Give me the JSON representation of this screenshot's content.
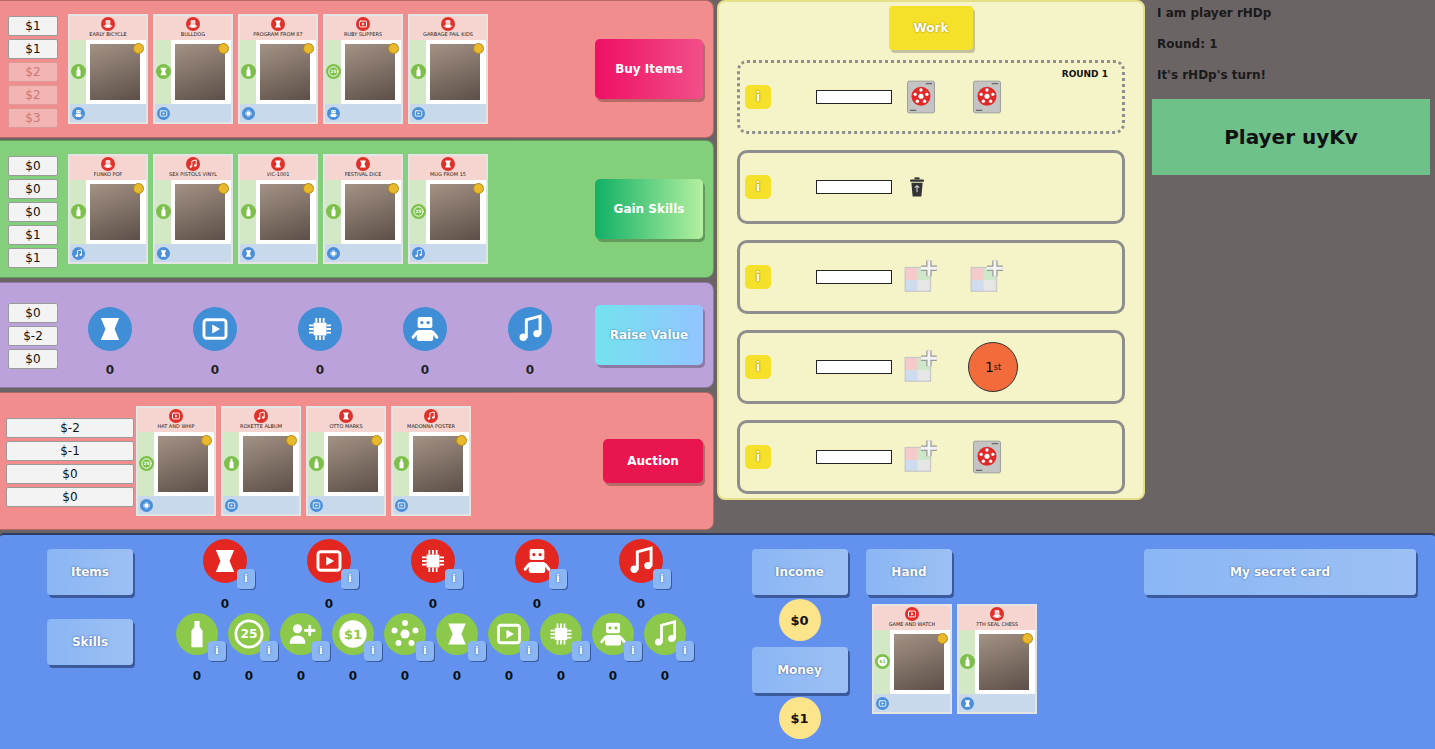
{
  "board": [
    {
      "button": "Buy Items",
      "prices": [
        {
          "text": "$1",
          "disabled": false
        },
        {
          "text": "$1",
          "disabled": false
        },
        {
          "text": "$2",
          "disabled": true
        },
        {
          "text": "$2",
          "disabled": true
        },
        {
          "text": "$3",
          "disabled": true
        }
      ],
      "cards": [
        {
          "title": "EARLY BICYCLE",
          "kind": "robot",
          "left": {
            "kind": "bottle"
          },
          "skill": "robot"
        },
        {
          "title": "BULLDOG",
          "kind": "robot",
          "left": {
            "kind": "book"
          },
          "skill": "video"
        },
        {
          "title": "PROGRAM FROM 87",
          "kind": "book",
          "left": {
            "kind": "bottle"
          },
          "skill": "chip"
        },
        {
          "title": "RUBY SLIPPERS",
          "kind": "video",
          "left": {
            "kind": "clock",
            "glyph": "25"
          },
          "skill": "robot"
        },
        {
          "title": "GARBAGE PAIL KIDS",
          "kind": "robot",
          "left": {
            "kind": "bottle"
          },
          "skill": "video"
        }
      ]
    },
    {
      "button": "Gain Skills",
      "prices": [
        {
          "text": "$0",
          "disabled": false
        },
        {
          "text": "$0",
          "disabled": false
        },
        {
          "text": "$0",
          "disabled": false
        },
        {
          "text": "$1",
          "disabled": false
        },
        {
          "text": "$1",
          "disabled": false
        }
      ],
      "cards": [
        {
          "title": "FUNKO POP",
          "kind": "robot",
          "left": {
            "kind": "bottle"
          },
          "skill": "music"
        },
        {
          "title": "SEX PISTOLS VINYL",
          "kind": "music",
          "left": {
            "kind": "bottle"
          },
          "skill": "book"
        },
        {
          "title": "VIC-1001",
          "kind": "book",
          "left": {
            "kind": "bottle"
          },
          "skill": "book"
        },
        {
          "title": "FESTIVAL DICE",
          "kind": "book",
          "left": {
            "kind": "bottle"
          },
          "skill": "chip"
        },
        {
          "title": "MUG FROM 15",
          "kind": "book",
          "left": {
            "kind": "clock",
            "glyph": "25"
          },
          "skill": "music"
        }
      ]
    },
    {
      "button": "Raise Value",
      "prices": [
        {
          "text": "$0",
          "disabled": false
        },
        {
          "text": "$-2",
          "disabled": false
        },
        {
          "text": "$0",
          "disabled": false
        }
      ],
      "tokens": [
        {
          "kind": "book",
          "count": "0"
        },
        {
          "kind": "video",
          "count": "0"
        },
        {
          "kind": "chip",
          "count": "0"
        },
        {
          "kind": "robot",
          "count": "0"
        },
        {
          "kind": "music",
          "count": "0"
        }
      ]
    },
    {
      "button": "Auction",
      "prices": [
        {
          "text": "$-2",
          "disabled": false
        },
        {
          "text": "$-1",
          "disabled": false
        },
        {
          "text": "$0",
          "disabled": false
        },
        {
          "text": "$0",
          "disabled": false
        }
      ],
      "cards": [
        {
          "title": "HAT AND WHIP",
          "kind": "video",
          "left": {
            "kind": "clock",
            "glyph": "25"
          },
          "skill": "chip"
        },
        {
          "title": "ROXETTE ALBUM",
          "kind": "music",
          "left": {
            "kind": "bottle"
          },
          "skill": "video"
        },
        {
          "title": "OTTO MARKS",
          "kind": "book",
          "left": {
            "kind": "bottle"
          },
          "skill": "video"
        },
        {
          "title": "MADONNA POSTER",
          "kind": "music",
          "left": {
            "kind": "bottle"
          },
          "skill": "video"
        }
      ]
    }
  ],
  "work": {
    "button": "Work",
    "info": "i",
    "slots": [
      {
        "current": true,
        "round": "ROUND 1",
        "value": "",
        "icons": [
          {
            "kind": "token"
          },
          {
            "kind": "token"
          }
        ]
      },
      {
        "current": false,
        "value": "",
        "icons": [
          {
            "kind": "recycle"
          }
        ]
      },
      {
        "current": false,
        "value": "",
        "icons": [
          {
            "kind": "add-card"
          },
          {
            "kind": "add-card"
          }
        ]
      },
      {
        "current": false,
        "value": "",
        "icons": [
          {
            "kind": "add-card"
          },
          {
            "kind": "first",
            "text": "1",
            "sup": "st"
          }
        ]
      },
      {
        "current": false,
        "value": "",
        "icons": [
          {
            "kind": "add-card"
          },
          {
            "kind": "token"
          }
        ]
      }
    ]
  },
  "status": {
    "player": "I am player rHDp",
    "round": "Round: 1",
    "turn": "It's rHDp's turn!",
    "opponent": "Player uyKv"
  },
  "tray": {
    "info": "i",
    "items_button": "Items",
    "items": [
      {
        "kind": "book",
        "count": "0"
      },
      {
        "kind": "video",
        "count": "0"
      },
      {
        "kind": "chip",
        "count": "0"
      },
      {
        "kind": "robot",
        "count": "0"
      },
      {
        "kind": "music",
        "count": "0"
      }
    ],
    "skills_button": "Skills",
    "skills": [
      {
        "kind": "bottle",
        "count": "0"
      },
      {
        "kind": "clock",
        "glyph": "25",
        "count": "0"
      },
      {
        "kind": "person-plus",
        "count": "0"
      },
      {
        "kind": "coin",
        "glyph": "$1",
        "count": "0"
      },
      {
        "kind": "worker",
        "count": "0"
      },
      {
        "kind": "book",
        "count": "0"
      },
      {
        "kind": "video",
        "count": "0"
      },
      {
        "kind": "chip",
        "count": "0"
      },
      {
        "kind": "robot",
        "count": "0"
      },
      {
        "kind": "music",
        "count": "0"
      }
    ],
    "income": {
      "button": "Income",
      "value": "$0"
    },
    "money": {
      "button": "Money",
      "value": "$1"
    },
    "hand": {
      "button": "Hand",
      "cards": [
        {
          "title": "GAME AND WATCH",
          "kind": "video",
          "left": {
            "kind": "coin",
            "glyph": "$1"
          },
          "skill": "video"
        },
        {
          "title": "7TH SEAL CHESS",
          "kind": "robot",
          "left": {
            "kind": "bottle"
          },
          "skill": "book"
        }
      ]
    },
    "secret_button": "My secret card"
  }
}
